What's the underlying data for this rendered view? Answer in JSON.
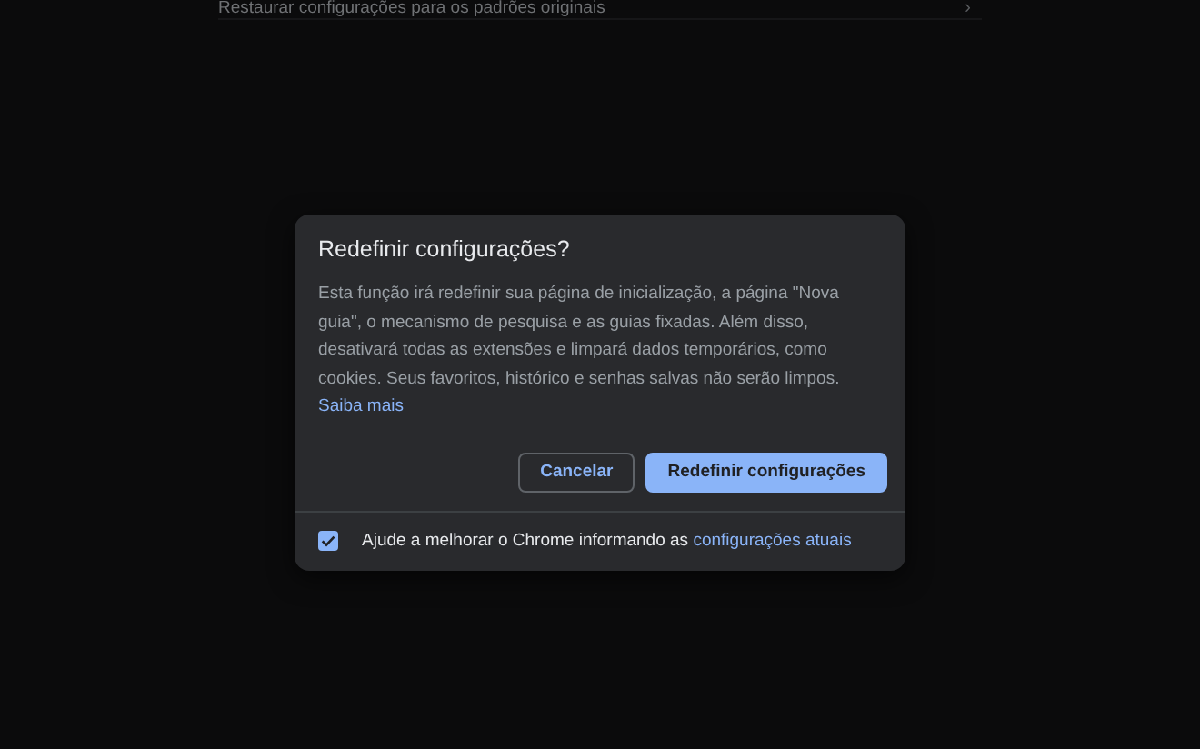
{
  "settings_row": {
    "label": "Restaurar configurações para os padrões originais",
    "chevron": "›"
  },
  "dialog": {
    "title": "Redefinir configurações?",
    "body": "Esta função irá redefinir sua página de inicialização, a página \"Nova guia\", o mecanismo de pesquisa e as guias fixadas. Além disso, desativará todas as extensões e limpará dados temporários, como cookies. Seus favoritos, histórico e senhas salvas não serão limpos.",
    "body_link": "Saiba mais",
    "buttons": [
      {
        "label": "Cancelar",
        "kind": "secondary"
      },
      {
        "label": "Redefinir configurações",
        "kind": "primary"
      }
    ],
    "footer": {
      "checked": true,
      "label": "Ajude a melhorar o Chrome informando as",
      "link": "configurações atuais"
    }
  }
}
